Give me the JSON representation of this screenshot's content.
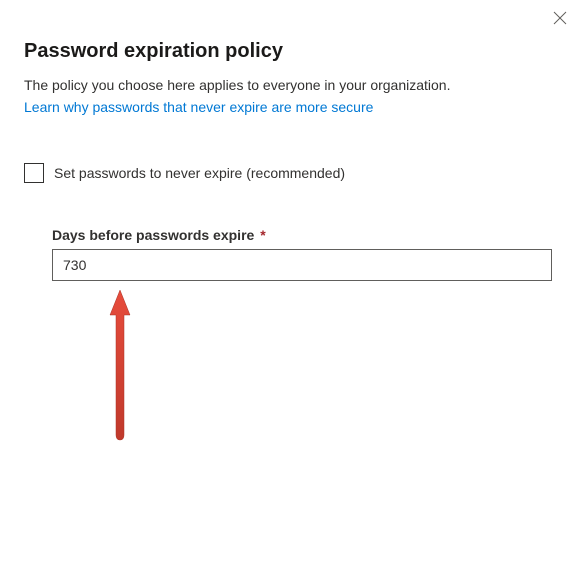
{
  "header": {
    "title": "Password expiration policy"
  },
  "body": {
    "description": "The policy you choose here applies to everyone in your organization.",
    "info_link_text": "Learn why passwords that never expire are more secure"
  },
  "options": {
    "never_expire_checkbox_label": "Set passwords to never expire (recommended)",
    "never_expire_checked": false
  },
  "form": {
    "days_label": "Days before passwords expire",
    "days_required_mark": "*",
    "days_value": "730"
  },
  "annotation": {
    "arrow_color": "#d13438"
  }
}
